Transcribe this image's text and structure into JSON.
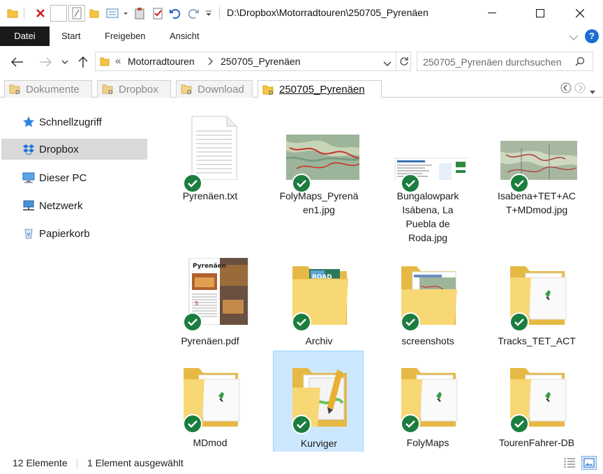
{
  "window": {
    "title": "D:\\Dropbox\\Motorradtouren\\250705_Pyrenäen",
    "minimize_symbol": "—",
    "maximize_symbol": "☐",
    "close_symbol": "✕"
  },
  "ribbon": {
    "tabs": [
      "Datei",
      "Start",
      "Freigeben",
      "Ansicht"
    ],
    "help": "?"
  },
  "address": {
    "segments": [
      "Motorradtouren",
      "250705_Pyrenäen"
    ],
    "overflow": "«",
    "search_placeholder": "250705_Pyrenäen durchsuchen"
  },
  "folder_tabs": [
    {
      "label": "Dokumente",
      "active": false
    },
    {
      "label": "Dropbox",
      "active": false
    },
    {
      "label": "Download",
      "active": false
    },
    {
      "label": "250705_Pyrenäen",
      "active": true
    }
  ],
  "sidebar": {
    "items": [
      {
        "label": "Schnellzugriff",
        "icon": "star-icon",
        "selected": false
      },
      {
        "label": "Dropbox",
        "icon": "dropbox-icon",
        "selected": true
      },
      {
        "label": "Dieser PC",
        "icon": "computer-icon",
        "selected": false
      },
      {
        "label": "Netzwerk",
        "icon": "network-icon",
        "selected": false
      },
      {
        "label": "Papierkorb",
        "icon": "recycle-bin-icon",
        "selected": false
      }
    ]
  },
  "files": [
    {
      "name": "Pyrenäen.txt",
      "lines": [
        "Pyrenäen.txt"
      ],
      "kind": "text-file",
      "synced": true
    },
    {
      "name": "FolyMaps_Pyrenäen1.jpg",
      "lines": [
        "FolyMaps_Pyrenä",
        "en1.jpg"
      ],
      "kind": "map-image",
      "synced": true
    },
    {
      "name": "Bungalowpark Isábena, La Puebla de Roda.jpg",
      "lines": [
        "Bungalowpark",
        "Isábena, La",
        "Puebla de",
        "Roda.jpg"
      ],
      "kind": "web-screenshot",
      "synced": true
    },
    {
      "name": "Isabena+TET+ACT+MDmod.jpg",
      "lines": [
        "Isabena+TET+AC",
        "T+MDmod.jpg"
      ],
      "kind": "map-image",
      "synced": true
    },
    {
      "name": "Pyrenäen.pdf",
      "lines": [
        "Pyrenäen.pdf"
      ],
      "kind": "pdf-document",
      "synced": true,
      "pdf_heading": "Pyrenäen"
    },
    {
      "name": "Archiv",
      "lines": [
        "Archiv"
      ],
      "kind": "folder-with-brochure",
      "synced": true
    },
    {
      "name": "screenshots",
      "lines": [
        "screenshots"
      ],
      "kind": "folder-with-maps",
      "synced": true
    },
    {
      "name": "Tracks_TET_ACT",
      "lines": [
        "Tracks_TET_ACT"
      ],
      "kind": "folder",
      "synced": true
    },
    {
      "name": "MDmod",
      "lines": [
        "MDmod"
      ],
      "kind": "folder",
      "synced": true
    },
    {
      "name": "Kurviger",
      "lines": [
        "Kurviger"
      ],
      "kind": "folder-with-app",
      "synced": true,
      "selected": true
    },
    {
      "name": "FolyMaps",
      "lines": [
        "FolyMaps"
      ],
      "kind": "folder",
      "synced": true
    },
    {
      "name": "TourenFahrer-DB",
      "lines": [
        "TourenFahrer-DB"
      ],
      "kind": "folder",
      "synced": true
    }
  ],
  "status": {
    "count": "12 Elemente",
    "selection": "1 Element ausgewählt"
  },
  "colors": {
    "sync_green": "#1b7d3f",
    "selection_bg": "#cce8ff",
    "folder_yellow": "#f8d775",
    "accent_blue": "#1a6fd1"
  }
}
